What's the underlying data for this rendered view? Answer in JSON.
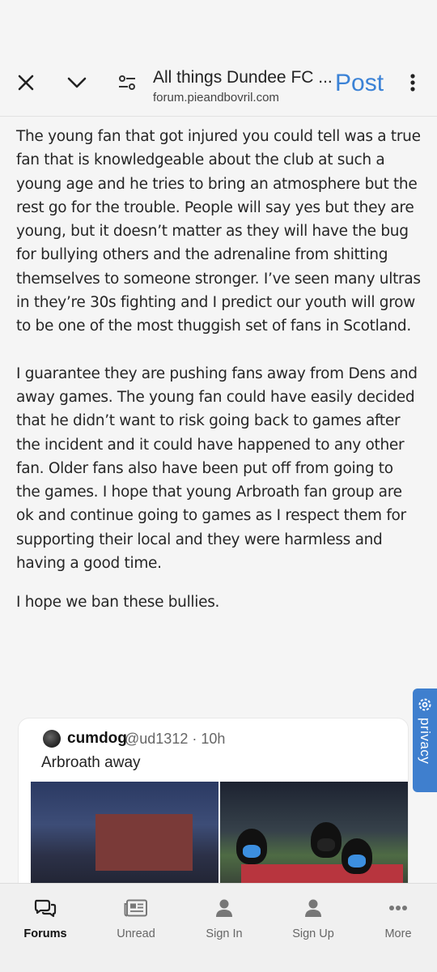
{
  "topbar": {
    "title": "All things Dundee FC ...",
    "url": "forum.pieandbovril.com",
    "post_label": "Post",
    "icons": [
      "close-icon",
      "chevron-down-icon",
      "site-settings-icon",
      "more-vert-icon"
    ]
  },
  "post": {
    "paragraphs": [
      "The young fan that got injured you could tell was a true fan that is knowledgeable about the club at such a young age and he tries to bring an atmosphere but the rest go for the trouble. People will say yes but they are young, but it doesn’t matter as they will have the bug for bullying others and the adrenaline from shitting themselves to someone stronger. I’ve seen many ultras in they’re 30s fighting and I predict our youth will grow to be one of the most thuggish set of fans in Scotland.",
      "I guarantee they are pushing fans away from Dens and away games. The young fan could have easily decided that he didn’t want to risk going back to games after the incident and it could have happened to any other fan. Older fans also have been put off from going to the games. I hope that young Arbroath fan group are ok and continue going to games as I respect them for supporting their local and they were harmless and having a good time.",
      "I hope we ban these bullies."
    ]
  },
  "privacy_tab": {
    "label": "privacy",
    "icon": "gear-icon"
  },
  "tweet": {
    "name": "cumdog",
    "handle_time": "@ud1312 · 10h",
    "text": "Arbroath away"
  },
  "bottom_nav": {
    "items": [
      {
        "label": "Forums",
        "icon": "chat-bubbles-icon",
        "active": true
      },
      {
        "label": "Unread",
        "icon": "newspaper-icon",
        "active": false
      },
      {
        "label": "Sign In",
        "icon": "user-icon",
        "active": false
      },
      {
        "label": "Sign Up",
        "icon": "user-icon",
        "active": false
      },
      {
        "label": "More",
        "icon": "dots-icon",
        "active": false
      }
    ]
  },
  "colors": {
    "accent": "#3b82d6",
    "privacy": "#3f7fce",
    "background": "#f5f5f5"
  }
}
